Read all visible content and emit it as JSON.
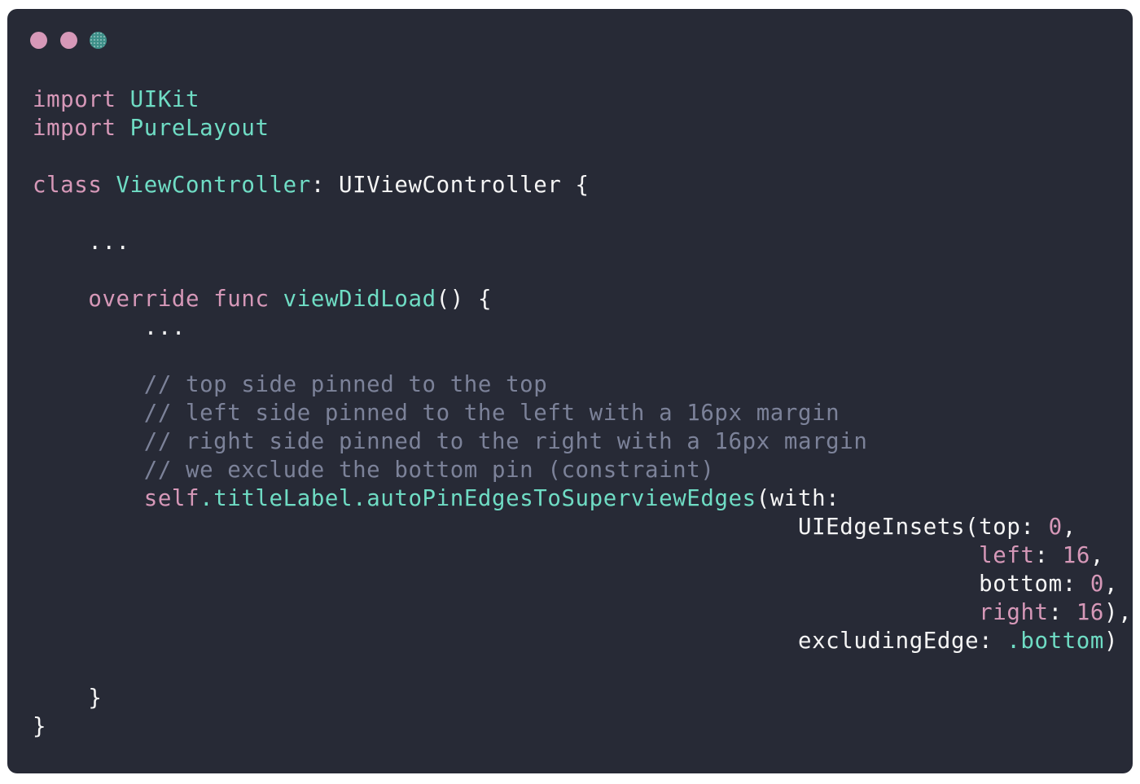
{
  "window": {
    "controls": [
      {
        "name": "close",
        "color": "#d698b8"
      },
      {
        "name": "minimize",
        "color": "#d698b8"
      },
      {
        "name": "zoom",
        "color": "#3d8f88"
      }
    ]
  },
  "colors": {
    "background": "#272a36",
    "keyword": "#d698b8",
    "type": "#6fdcc4",
    "plain": "#f5f5f5",
    "comment": "#7c8299"
  },
  "code": {
    "lines": [
      [
        {
          "t": "import",
          "k": "kw"
        },
        {
          "t": " ",
          "k": "pl"
        },
        {
          "t": "UIKit",
          "k": "ty"
        }
      ],
      [
        {
          "t": "import",
          "k": "kw"
        },
        {
          "t": " ",
          "k": "pl"
        },
        {
          "t": "PureLayout",
          "k": "ty"
        }
      ],
      [],
      [
        {
          "t": "class",
          "k": "kw"
        },
        {
          "t": " ",
          "k": "pl"
        },
        {
          "t": "ViewController",
          "k": "ty"
        },
        {
          "t": ": UIViewController {",
          "k": "pl"
        }
      ],
      [],
      [
        {
          "t": "    ...",
          "k": "pl"
        }
      ],
      [],
      [
        {
          "t": "    ",
          "k": "pl"
        },
        {
          "t": "override",
          "k": "kw"
        },
        {
          "t": " ",
          "k": "pl"
        },
        {
          "t": "func",
          "k": "kw"
        },
        {
          "t": " ",
          "k": "pl"
        },
        {
          "t": "viewDidLoad",
          "k": "ty"
        },
        {
          "t": "() {",
          "k": "pl"
        }
      ],
      [
        {
          "t": "        ...",
          "k": "pl"
        }
      ],
      [],
      [
        {
          "t": "        // top side pinned to the top",
          "k": "cm"
        }
      ],
      [
        {
          "t": "        // left side pinned to the left with a 16px margin",
          "k": "cm"
        }
      ],
      [
        {
          "t": "        // right side pinned to the right with a 16px margin",
          "k": "cm"
        }
      ],
      [
        {
          "t": "        // we exclude the bottom pin (constraint)",
          "k": "cm"
        }
      ],
      [
        {
          "t": "        ",
          "k": "pl"
        },
        {
          "t": "self",
          "k": "kw"
        },
        {
          "t": ".titleLabel.autoPinEdgesToSuperviewEdges",
          "k": "ty"
        },
        {
          "t": "(with:",
          "k": "pl"
        }
      ],
      [
        {
          "t": "                                                       UIEdgeInsets(top: ",
          "k": "pl"
        },
        {
          "t": "0",
          "k": "num"
        },
        {
          "t": ",",
          "k": "pl"
        }
      ],
      [
        {
          "t": "                                                                    ",
          "k": "pl"
        },
        {
          "t": "left",
          "k": "lbl"
        },
        {
          "t": ": ",
          "k": "pl"
        },
        {
          "t": "16",
          "k": "num"
        },
        {
          "t": ",",
          "k": "pl"
        }
      ],
      [
        {
          "t": "                                                                    bottom: ",
          "k": "pl"
        },
        {
          "t": "0",
          "k": "num"
        },
        {
          "t": ",",
          "k": "pl"
        }
      ],
      [
        {
          "t": "                                                                    ",
          "k": "pl"
        },
        {
          "t": "right",
          "k": "lbl"
        },
        {
          "t": ": ",
          "k": "pl"
        },
        {
          "t": "16",
          "k": "num"
        },
        {
          "t": "),",
          "k": "pl"
        }
      ],
      [
        {
          "t": "                                                       excludingEdge: ",
          "k": "pl"
        },
        {
          "t": ".bottom",
          "k": "ty"
        },
        {
          "t": ")",
          "k": "pl"
        }
      ],
      [],
      [
        {
          "t": "    }",
          "k": "pl"
        }
      ],
      [
        {
          "t": "}",
          "k": "pl"
        }
      ]
    ]
  }
}
